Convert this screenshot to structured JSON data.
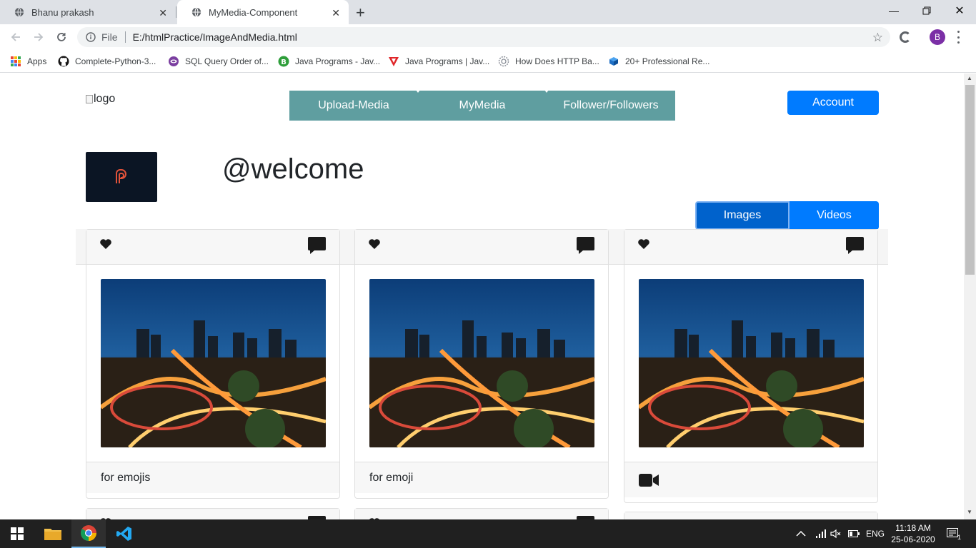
{
  "browser": {
    "tabs": [
      {
        "title": "Bhanu prakash",
        "active": false
      },
      {
        "title": "MyMedia-Component",
        "active": true
      }
    ],
    "address": {
      "scheme_label": "File",
      "url": "E:/htmlPractice/ImageAndMedia.html"
    },
    "profile_initial": "B",
    "bookmarks": [
      {
        "label": "Apps",
        "icon": "apps-grid-icon"
      },
      {
        "label": "Complete-Python-3...",
        "icon": "github-icon"
      },
      {
        "label": "SQL Query Order of...",
        "icon": "purple-circle-icon"
      },
      {
        "label": "Java Programs - Jav...",
        "icon": "green-b-icon"
      },
      {
        "label": "Java Programs | Jav...",
        "icon": "red-v-icon"
      },
      {
        "label": "How Does HTTP Ba...",
        "icon": "gear-globe-icon"
      },
      {
        "label": "20+ Professional Re...",
        "icon": "blue-cube-icon"
      }
    ]
  },
  "page": {
    "logo_alt": "logo",
    "nav": [
      "Upload-Media",
      "MyMedia",
      "Follower/Followers"
    ],
    "account_label": "Account",
    "welcome": "@welcome",
    "media_toggle": {
      "images": "Images",
      "videos": "Videos",
      "selected": "Images"
    },
    "cards": [
      {
        "caption": "for emojis",
        "footer_icon": ""
      },
      {
        "caption": "for emoji",
        "footer_icon": ""
      },
      {
        "caption": "",
        "footer_icon": "video-camera-icon"
      }
    ]
  },
  "taskbar": {
    "language": "ENG",
    "time": "11:18 AM",
    "date": "25-06-2020",
    "notification_count": "1"
  },
  "colors": {
    "nav_bg": "#5f9ea0",
    "primary": "#007bff",
    "primary_active": "#0062cc",
    "avatar_bg": "#0b1524"
  }
}
